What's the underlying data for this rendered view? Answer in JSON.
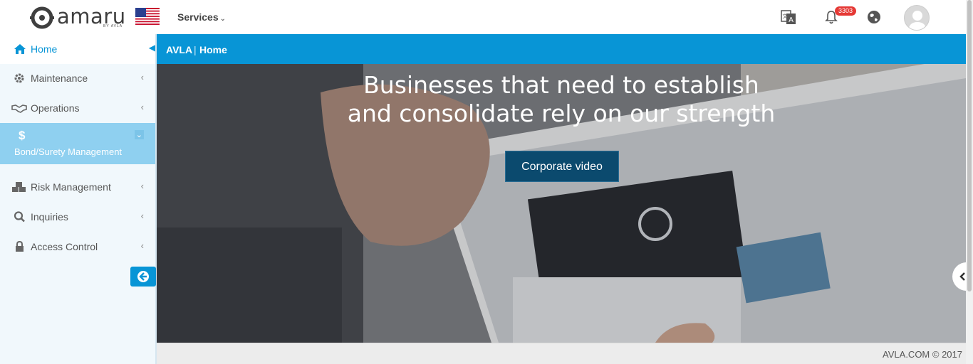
{
  "header": {
    "logo_text": "amaru",
    "logo_subtext": "BY AVLA",
    "services_label": "Services",
    "notification_count": "3303"
  },
  "breadcrumb": {
    "root": "AVLA",
    "separator": "|",
    "current": "Home"
  },
  "sidebar": {
    "items": [
      {
        "label": "Home",
        "icon": "home-icon",
        "state": "selected"
      },
      {
        "label": "Maintenance",
        "icon": "gear-icon"
      },
      {
        "label": "Operations",
        "icon": "handshake-icon"
      },
      {
        "label": "Bond/Surety Management",
        "icon": "dollar-icon",
        "state": "expanded"
      },
      {
        "label": "Risk Management",
        "icon": "cubes-icon"
      },
      {
        "label": "Inquiries",
        "icon": "search-icon"
      },
      {
        "label": "Access Control",
        "icon": "lock-icon"
      }
    ]
  },
  "hero": {
    "title_line1": "Businesses that need to establish",
    "title_line2": "and consolidate rely on our strength",
    "button_label": "Corporate video"
  },
  "footer": {
    "copyright": "AVLA.COM © 2017"
  },
  "colors": {
    "primary": "#0895d6",
    "active_item": "#8fd0f0",
    "video_button": "#0b4a6e",
    "badge": "#e53935"
  }
}
